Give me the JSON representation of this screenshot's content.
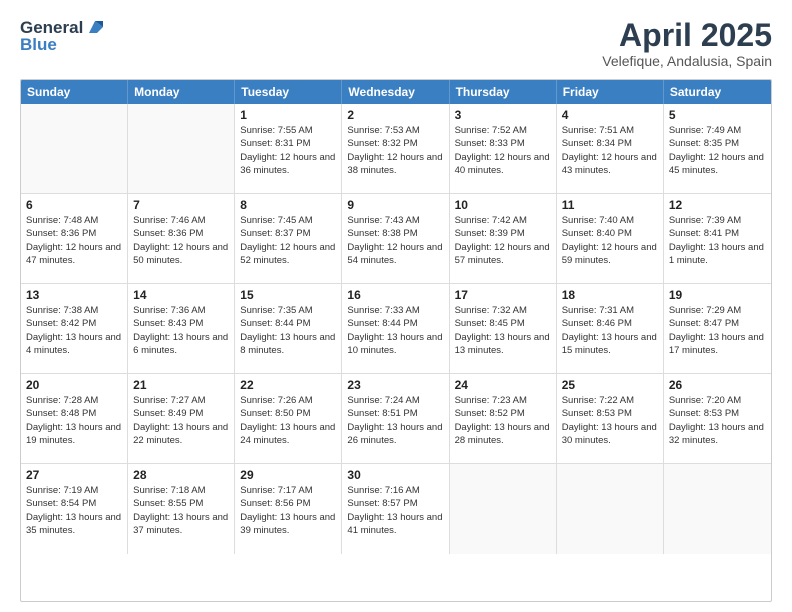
{
  "logo": {
    "line1": "General",
    "line2": "Blue"
  },
  "title": "April 2025",
  "subtitle": "Velefique, Andalusia, Spain",
  "days_of_week": [
    "Sunday",
    "Monday",
    "Tuesday",
    "Wednesday",
    "Thursday",
    "Friday",
    "Saturday"
  ],
  "weeks": [
    [
      {
        "day": "",
        "empty": true
      },
      {
        "day": "",
        "empty": true
      },
      {
        "day": "1",
        "sunrise": "Sunrise: 7:55 AM",
        "sunset": "Sunset: 8:31 PM",
        "daylight": "Daylight: 12 hours and 36 minutes."
      },
      {
        "day": "2",
        "sunrise": "Sunrise: 7:53 AM",
        "sunset": "Sunset: 8:32 PM",
        "daylight": "Daylight: 12 hours and 38 minutes."
      },
      {
        "day": "3",
        "sunrise": "Sunrise: 7:52 AM",
        "sunset": "Sunset: 8:33 PM",
        "daylight": "Daylight: 12 hours and 40 minutes."
      },
      {
        "day": "4",
        "sunrise": "Sunrise: 7:51 AM",
        "sunset": "Sunset: 8:34 PM",
        "daylight": "Daylight: 12 hours and 43 minutes."
      },
      {
        "day": "5",
        "sunrise": "Sunrise: 7:49 AM",
        "sunset": "Sunset: 8:35 PM",
        "daylight": "Daylight: 12 hours and 45 minutes."
      }
    ],
    [
      {
        "day": "6",
        "sunrise": "Sunrise: 7:48 AM",
        "sunset": "Sunset: 8:36 PM",
        "daylight": "Daylight: 12 hours and 47 minutes."
      },
      {
        "day": "7",
        "sunrise": "Sunrise: 7:46 AM",
        "sunset": "Sunset: 8:36 PM",
        "daylight": "Daylight: 12 hours and 50 minutes."
      },
      {
        "day": "8",
        "sunrise": "Sunrise: 7:45 AM",
        "sunset": "Sunset: 8:37 PM",
        "daylight": "Daylight: 12 hours and 52 minutes."
      },
      {
        "day": "9",
        "sunrise": "Sunrise: 7:43 AM",
        "sunset": "Sunset: 8:38 PM",
        "daylight": "Daylight: 12 hours and 54 minutes."
      },
      {
        "day": "10",
        "sunrise": "Sunrise: 7:42 AM",
        "sunset": "Sunset: 8:39 PM",
        "daylight": "Daylight: 12 hours and 57 minutes."
      },
      {
        "day": "11",
        "sunrise": "Sunrise: 7:40 AM",
        "sunset": "Sunset: 8:40 PM",
        "daylight": "Daylight: 12 hours and 59 minutes."
      },
      {
        "day": "12",
        "sunrise": "Sunrise: 7:39 AM",
        "sunset": "Sunset: 8:41 PM",
        "daylight": "Daylight: 13 hours and 1 minute."
      }
    ],
    [
      {
        "day": "13",
        "sunrise": "Sunrise: 7:38 AM",
        "sunset": "Sunset: 8:42 PM",
        "daylight": "Daylight: 13 hours and 4 minutes."
      },
      {
        "day": "14",
        "sunrise": "Sunrise: 7:36 AM",
        "sunset": "Sunset: 8:43 PM",
        "daylight": "Daylight: 13 hours and 6 minutes."
      },
      {
        "day": "15",
        "sunrise": "Sunrise: 7:35 AM",
        "sunset": "Sunset: 8:44 PM",
        "daylight": "Daylight: 13 hours and 8 minutes."
      },
      {
        "day": "16",
        "sunrise": "Sunrise: 7:33 AM",
        "sunset": "Sunset: 8:44 PM",
        "daylight": "Daylight: 13 hours and 10 minutes."
      },
      {
        "day": "17",
        "sunrise": "Sunrise: 7:32 AM",
        "sunset": "Sunset: 8:45 PM",
        "daylight": "Daylight: 13 hours and 13 minutes."
      },
      {
        "day": "18",
        "sunrise": "Sunrise: 7:31 AM",
        "sunset": "Sunset: 8:46 PM",
        "daylight": "Daylight: 13 hours and 15 minutes."
      },
      {
        "day": "19",
        "sunrise": "Sunrise: 7:29 AM",
        "sunset": "Sunset: 8:47 PM",
        "daylight": "Daylight: 13 hours and 17 minutes."
      }
    ],
    [
      {
        "day": "20",
        "sunrise": "Sunrise: 7:28 AM",
        "sunset": "Sunset: 8:48 PM",
        "daylight": "Daylight: 13 hours and 19 minutes."
      },
      {
        "day": "21",
        "sunrise": "Sunrise: 7:27 AM",
        "sunset": "Sunset: 8:49 PM",
        "daylight": "Daylight: 13 hours and 22 minutes."
      },
      {
        "day": "22",
        "sunrise": "Sunrise: 7:26 AM",
        "sunset": "Sunset: 8:50 PM",
        "daylight": "Daylight: 13 hours and 24 minutes."
      },
      {
        "day": "23",
        "sunrise": "Sunrise: 7:24 AM",
        "sunset": "Sunset: 8:51 PM",
        "daylight": "Daylight: 13 hours and 26 minutes."
      },
      {
        "day": "24",
        "sunrise": "Sunrise: 7:23 AM",
        "sunset": "Sunset: 8:52 PM",
        "daylight": "Daylight: 13 hours and 28 minutes."
      },
      {
        "day": "25",
        "sunrise": "Sunrise: 7:22 AM",
        "sunset": "Sunset: 8:53 PM",
        "daylight": "Daylight: 13 hours and 30 minutes."
      },
      {
        "day": "26",
        "sunrise": "Sunrise: 7:20 AM",
        "sunset": "Sunset: 8:53 PM",
        "daylight": "Daylight: 13 hours and 32 minutes."
      }
    ],
    [
      {
        "day": "27",
        "sunrise": "Sunrise: 7:19 AM",
        "sunset": "Sunset: 8:54 PM",
        "daylight": "Daylight: 13 hours and 35 minutes."
      },
      {
        "day": "28",
        "sunrise": "Sunrise: 7:18 AM",
        "sunset": "Sunset: 8:55 PM",
        "daylight": "Daylight: 13 hours and 37 minutes."
      },
      {
        "day": "29",
        "sunrise": "Sunrise: 7:17 AM",
        "sunset": "Sunset: 8:56 PM",
        "daylight": "Daylight: 13 hours and 39 minutes."
      },
      {
        "day": "30",
        "sunrise": "Sunrise: 7:16 AM",
        "sunset": "Sunset: 8:57 PM",
        "daylight": "Daylight: 13 hours and 41 minutes."
      },
      {
        "day": "",
        "empty": true
      },
      {
        "day": "",
        "empty": true
      },
      {
        "day": "",
        "empty": true
      }
    ]
  ]
}
